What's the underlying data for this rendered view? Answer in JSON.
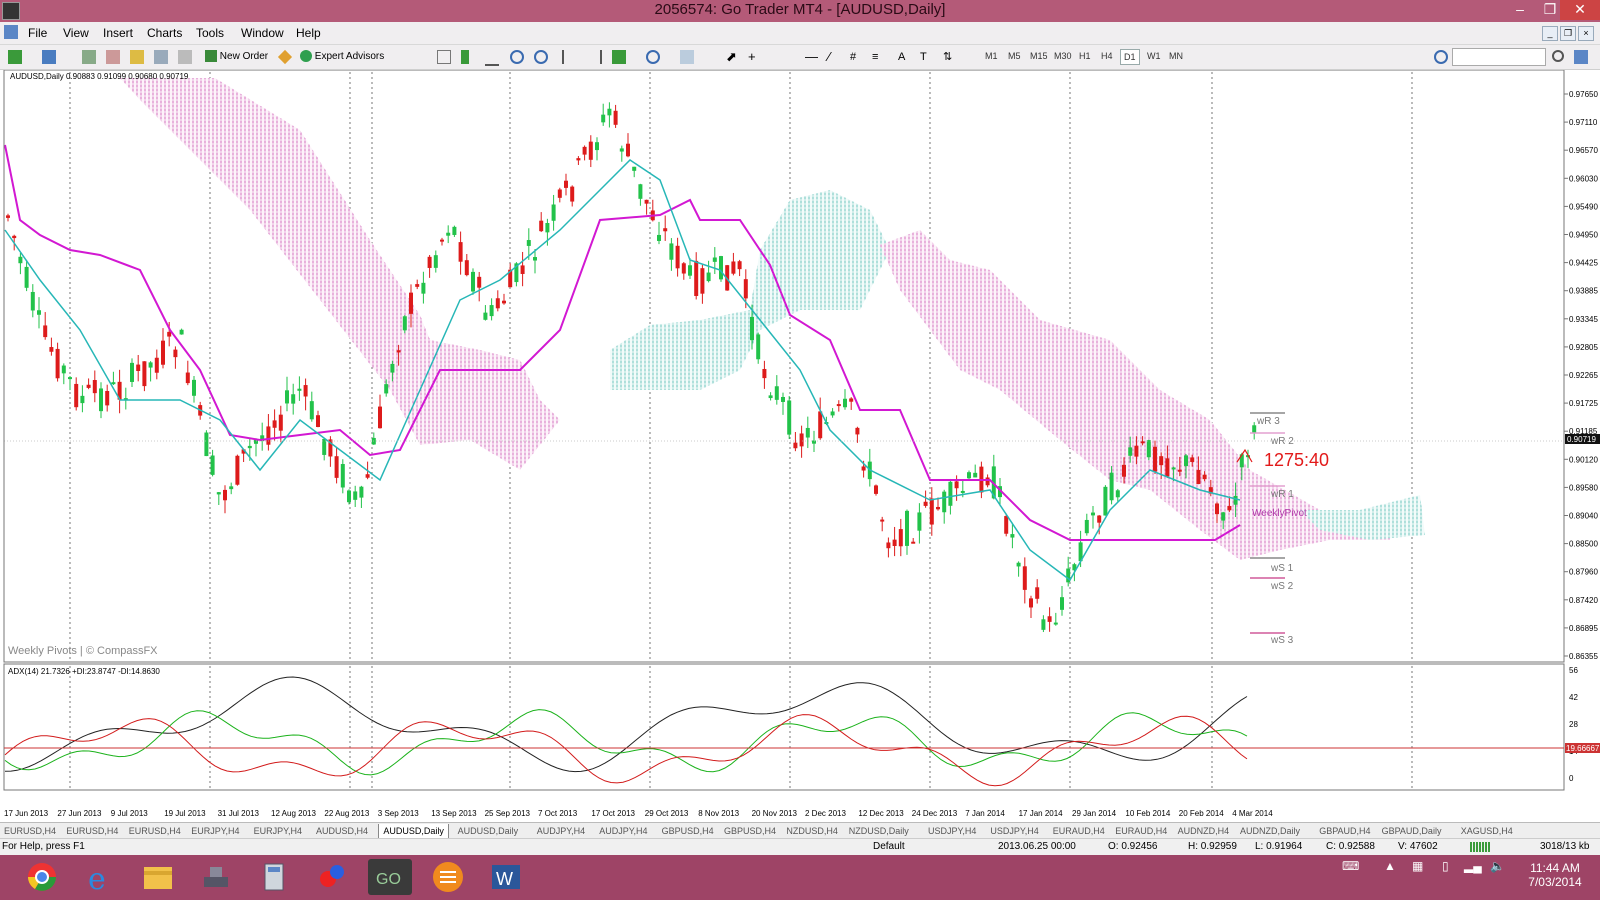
{
  "window": {
    "title": "2056574: Go Trader MT4 - [AUDUSD,Daily]"
  },
  "menu": [
    "File",
    "View",
    "Insert",
    "Charts",
    "Tools",
    "Window",
    "Help"
  ],
  "toolbar": {
    "new_order": "New Order",
    "expert_advisors": "Expert Advisors",
    "timeframes": [
      "M1",
      "M5",
      "M15",
      "M30",
      "H1",
      "H4",
      "D1",
      "W1",
      "MN"
    ],
    "selected_timeframe": "D1"
  },
  "chart": {
    "header": "AUDUSD,Daily  0.90883 0.91099 0.90680 0.90719",
    "watermark": "Weekly Pivots | © CompassFX",
    "countdown": "1275:40",
    "current_price": "0.90719",
    "price_ticks": [
      "0.97650",
      "0.97110",
      "0.96570",
      "0.96030",
      "0.95490",
      "0.94950",
      "0.94425",
      "0.93885",
      "0.93345",
      "0.92805",
      "0.92265",
      "0.91725",
      "0.91185",
      "0.90719",
      "0.90120",
      "0.89580",
      "0.89040",
      "0.88500",
      "0.87960",
      "0.87420",
      "0.86895",
      "0.86355"
    ],
    "pivot_labels": {
      "wr3": "wR 3",
      "wr2": "wR 2",
      "wr1": "wR 1",
      "wp": "WeeklyPivot",
      "ws1": "wS 1",
      "ws2": "wS 2",
      "ws3": "wS 3"
    },
    "adx_header": "ADX(14) 21.7326 +DI:23.8747 -DI:14.8630",
    "adx_ticks": [
      "56",
      "42",
      "28",
      "14",
      "0"
    ],
    "adx_level": "19.66667",
    "date_labels": [
      "17 Jun 2013",
      "27 Jun 2013",
      "9 Jul 2013",
      "19 Jul 2013",
      "31 Jul 2013",
      "12 Aug 2013",
      "22 Aug 2013",
      "3 Sep 2013",
      "13 Sep 2013",
      "25 Sep 2013",
      "7 Oct 2013",
      "17 Oct 2013",
      "29 Oct 2013",
      "8 Nov 2013",
      "20 Nov 2013",
      "2 Dec 2013",
      "12 Dec 2013",
      "24 Dec 2013",
      "7 Jan 2014",
      "17 Jan 2014",
      "29 Jan 2014",
      "10 Feb 2014",
      "20 Feb 2014",
      "4 Mar 2014"
    ]
  },
  "chart_data": {
    "type": "candlestick",
    "symbol": "AUDUSD",
    "timeframe": "Daily",
    "ylim": [
      0.86355,
      0.9765
    ],
    "last_ohlc": {
      "open": 0.90883,
      "high": 0.91099,
      "low": 0.9068,
      "close": 0.90719
    },
    "adx": {
      "adx": 21.7326,
      "plus_di": 23.8747,
      "minus_di": 14.863,
      "level": 19.66667,
      "ylim": [
        0,
        56
      ]
    }
  },
  "tabs": [
    "EURUSD,H4",
    "EURUSD,H4",
    "EURUSD,H4",
    "EURJPY,H4",
    "EURJPY,H4",
    "AUDUSD,H4",
    "AUDUSD,Daily",
    "AUDUSD,Daily",
    "AUDJPY,H4",
    "AUDJPY,H4",
    "GBPUSD,H4",
    "GBPUSD,H4",
    "NZDUSD,H4",
    "NZDUSD,Daily",
    "USDJPY,H4",
    "USDJPY,H4",
    "EURAUD,H4",
    "EURAUD,H4",
    "AUDNZD,H4",
    "AUDNZD,Daily",
    "GBPAUD,H4",
    "GBPAUD,Daily",
    "XAGUSD,H4"
  ],
  "active_tab": 6,
  "status": {
    "help": "For Help, press F1",
    "profile": "Default",
    "datetime": "2013.06.25 00:00",
    "open": "O: 0.92456",
    "high": "H: 0.92959",
    "low": "L: 0.91964",
    "close": "C: 0.92588",
    "volume": "V: 47602",
    "traffic": "3018/13 kb"
  },
  "taskbar": {
    "time": "11:44 AM",
    "date": "7/03/2014"
  }
}
